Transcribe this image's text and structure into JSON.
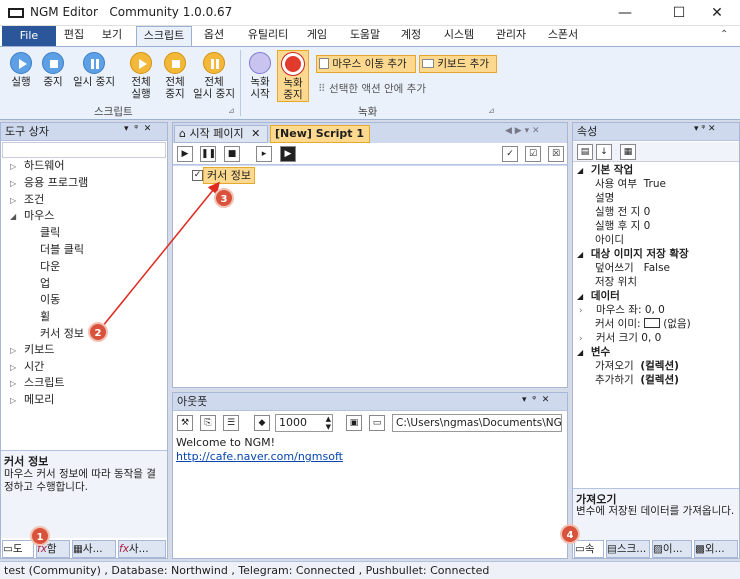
{
  "window": {
    "app_name": "NGM Editor",
    "edition": "Community 1.0.0.67",
    "minimize": "—",
    "maximize": "☐",
    "close": "✕"
  },
  "menu": {
    "tabs": [
      "File",
      "편집",
      "보기",
      "스크립트",
      "옵션",
      "유틸리티",
      "게임",
      "도움말",
      "계정",
      "시스템",
      "관리자",
      "스폰서"
    ],
    "active": "스크립트"
  },
  "ribbon": {
    "script_group": {
      "label": "스크립트",
      "run": "실행",
      "stop": "중지",
      "pause": "일시 중지",
      "run_all_1": "전체",
      "run_all_2": "실행",
      "stop_all_1": "전체",
      "stop_all_2": "중지",
      "pause_all_1": "전체",
      "pause_all_2": "일시 중지"
    },
    "record_group": {
      "label": "녹화",
      "rec_start_1": "녹화",
      "rec_start_2": "시작",
      "rec_stop_1": "녹화",
      "rec_stop_2": "중지",
      "add_mouse_move": "마우스 이동 추가",
      "add_keyboard": "키보드 추가",
      "inside_selected_action": "선택한 액션 안에 추가"
    }
  },
  "toolbox": {
    "title": "도구 상자",
    "items": {
      "hardware": "하드웨어",
      "app": "응용 프로그램",
      "condition": "조건",
      "mouse": "마우스",
      "click": "클릭",
      "double_click": "더블 클릭",
      "down": "다운",
      "up": "업",
      "move": "이동",
      "wheel": "휠",
      "cursor_info": "커서 정보",
      "keyboard": "키보드",
      "time": "시간",
      "script": "스크립트",
      "memory": "메모리"
    },
    "desc_title": "커서 정보",
    "desc_body": "마우스 커서 정보에 따라 동작을 결정하고 수행합니다.",
    "bottom_tabs": [
      "도",
      "함",
      "사...",
      "사..."
    ]
  },
  "editor": {
    "tab_start": "시작 페이지",
    "tab_script": "[New] Script 1",
    "node_label": "커서 정보"
  },
  "output": {
    "title": "아웃풋",
    "count": "1000",
    "path": "C:\\Users\\ngmas\\Documents\\NGM5\\",
    "welcome": "Welcome to NGM!",
    "link": "http://cafe.naver.com/ngmsoft"
  },
  "properties": {
    "title": "속성",
    "cat_basic": "기본 작업",
    "use": "사용 여부",
    "use_val": "True",
    "desc": "설명",
    "before": "실행 전 지",
    "before_val": "0",
    "after": "실행 후 지",
    "after_val": "0",
    "id": "아이디",
    "cat_image": "대상 이미지 저장 확장",
    "overwrite": "덮어쓰기",
    "overwrite_val": "False",
    "save_loc": "저장 위치",
    "cat_data": "데이터",
    "mouse_pos": "마우스 좌:",
    "mouse_pos_val": "0, 0",
    "cursor_img": "커서 이미:",
    "cursor_img_val": "(없음)",
    "cursor_size": "커서 크기",
    "cursor_size_val": "0, 0",
    "cat_var": "변수",
    "get": "가져오기",
    "get_val": "(컬렉션)",
    "add": "추가하기",
    "add_val": "(컬렉션)",
    "desc_title": "가져오기",
    "desc_body": "변수에 저장된 데이터를 가져옵니다.",
    "bottom_tabs": [
      "속",
      "스크...",
      "이...",
      "외..."
    ]
  },
  "annotations": [
    "1",
    "2",
    "3",
    "4"
  ],
  "status": {
    "text": "test (Community)  , Database: Northwind  , Telegram: Connected  , Pushbullet: Connected"
  },
  "colors": {
    "accent": "#2b579a",
    "badge": "#d9533c",
    "highlight": "#fcd98e",
    "link": "#0645ad"
  }
}
